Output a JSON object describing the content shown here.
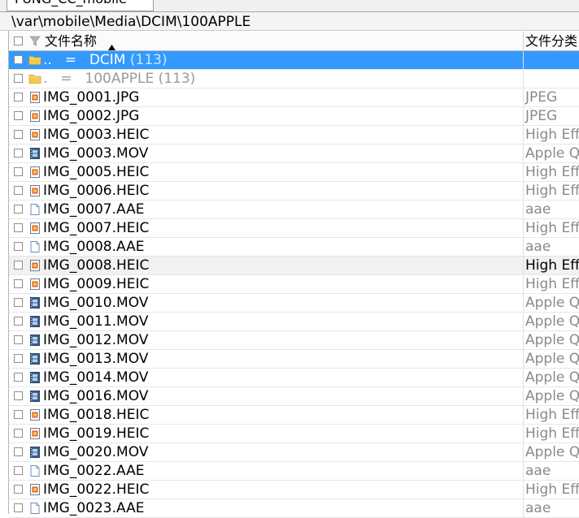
{
  "tab": {
    "label": "FUNG_CC_mobile"
  },
  "path": "\\var\\mobile\\Media\\DCIM\\100APPLE",
  "columns": {
    "name": "文件名称",
    "type": "文件分类"
  },
  "dirs": [
    {
      "dots": "..",
      "eq": "=",
      "name": "DCIM",
      "count": "(113)",
      "state": "selected"
    },
    {
      "dots": ".",
      "eq": "=",
      "name": "100APPLE",
      "count": "(113)",
      "state": "parent"
    }
  ],
  "files": [
    {
      "name": "IMG_0001.JPG",
      "type": "JPEG",
      "icon": "image-file-icon"
    },
    {
      "name": "IMG_0002.JPG",
      "type": "JPEG",
      "icon": "image-file-icon"
    },
    {
      "name": "IMG_0003.HEIC",
      "type": "High Efficiency Image",
      "icon": "image-file-icon"
    },
    {
      "name": "IMG_0003.MOV",
      "type": "Apple QuickTime",
      "icon": "video-file-icon"
    },
    {
      "name": "IMG_0005.HEIC",
      "type": "High Efficiency Image",
      "icon": "image-file-icon"
    },
    {
      "name": "IMG_0006.HEIC",
      "type": "High Efficiency Image",
      "icon": "image-file-icon"
    },
    {
      "name": "IMG_0007.AAE",
      "type": "aae",
      "icon": "document-file-icon"
    },
    {
      "name": "IMG_0007.HEIC",
      "type": "High Efficiency Image",
      "icon": "image-file-icon"
    },
    {
      "name": "IMG_0008.AAE",
      "type": "aae",
      "icon": "document-file-icon"
    },
    {
      "name": "IMG_0008.HEIC",
      "type": "High Efficiency Image",
      "icon": "image-file-icon",
      "state": "hover"
    },
    {
      "name": "IMG_0009.HEIC",
      "type": "High Efficiency Image",
      "icon": "image-file-icon"
    },
    {
      "name": "IMG_0010.MOV",
      "type": "Apple QuickTime",
      "icon": "video-file-icon"
    },
    {
      "name": "IMG_0011.MOV",
      "type": "Apple QuickTime",
      "icon": "video-file-icon"
    },
    {
      "name": "IMG_0012.MOV",
      "type": "Apple QuickTime",
      "icon": "video-file-icon"
    },
    {
      "name": "IMG_0013.MOV",
      "type": "Apple QuickTime",
      "icon": "video-file-icon"
    },
    {
      "name": "IMG_0014.MOV",
      "type": "Apple QuickTime",
      "icon": "video-file-icon"
    },
    {
      "name": "IMG_0016.MOV",
      "type": "Apple QuickTime",
      "icon": "video-file-icon"
    },
    {
      "name": "IMG_0018.HEIC",
      "type": "High Efficiency Image",
      "icon": "image-file-icon"
    },
    {
      "name": "IMG_0019.HEIC",
      "type": "High Efficiency Image",
      "icon": "image-file-icon"
    },
    {
      "name": "IMG_0020.MOV",
      "type": "Apple QuickTime",
      "icon": "video-file-icon"
    },
    {
      "name": "IMG_0022.AAE",
      "type": "aae",
      "icon": "document-file-icon"
    },
    {
      "name": "IMG_0022.HEIC",
      "type": "High Efficiency Image",
      "icon": "image-file-icon"
    },
    {
      "name": "IMG_0023.AAE",
      "type": "aae",
      "icon": "document-file-icon"
    }
  ],
  "colors": {
    "selection": "#3399ff",
    "folder": "#f3c94a",
    "muted_text": "#8a8a8a"
  }
}
